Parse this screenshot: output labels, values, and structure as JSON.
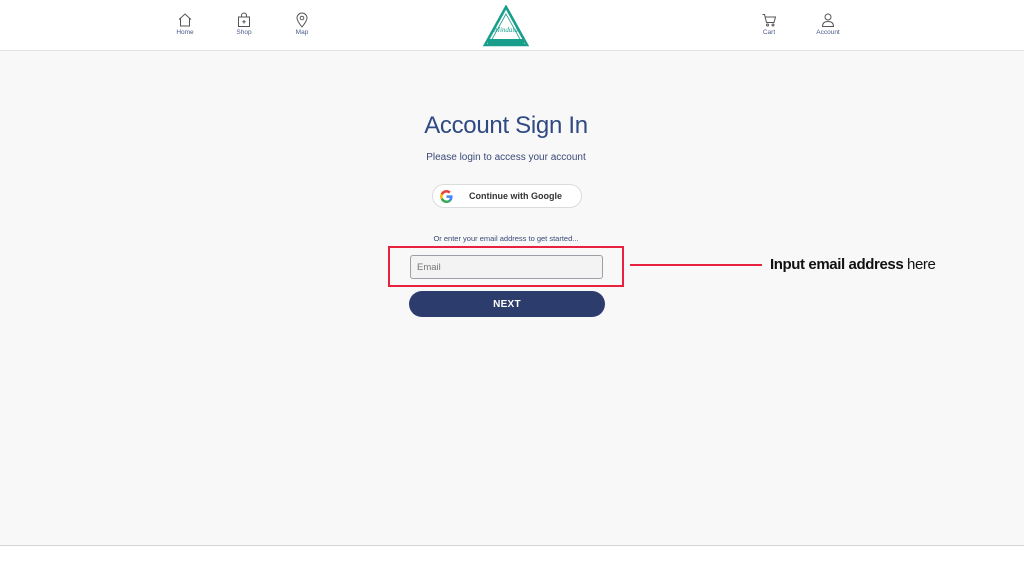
{
  "nav": {
    "left": [
      {
        "label": "Home",
        "icon": "home-icon"
      },
      {
        "label": "Shop",
        "icon": "shop-bag-icon"
      },
      {
        "label": "Map",
        "icon": "map-pin-icon"
      }
    ],
    "right": [
      {
        "label": "Cart",
        "icon": "cart-icon"
      },
      {
        "label": "Account",
        "icon": "user-icon"
      }
    ],
    "logo_icon": "triangle-logo-icon",
    "logo_text": "Mindala"
  },
  "main": {
    "title": "Account Sign In",
    "subtitle": "Please login to access your account",
    "google_button_label": "Continue with Google",
    "or_text": "Or enter your email address to get started...",
    "email_placeholder": "Email",
    "email_value": "",
    "next_label": "NEXT"
  },
  "annotation": {
    "bold_text": "Input email address",
    "plain_text": " here"
  },
  "colors": {
    "accent": "#2c3c6c",
    "title": "#2f4a83",
    "highlight": "#e8213f",
    "logo": "#1a9e8c"
  }
}
